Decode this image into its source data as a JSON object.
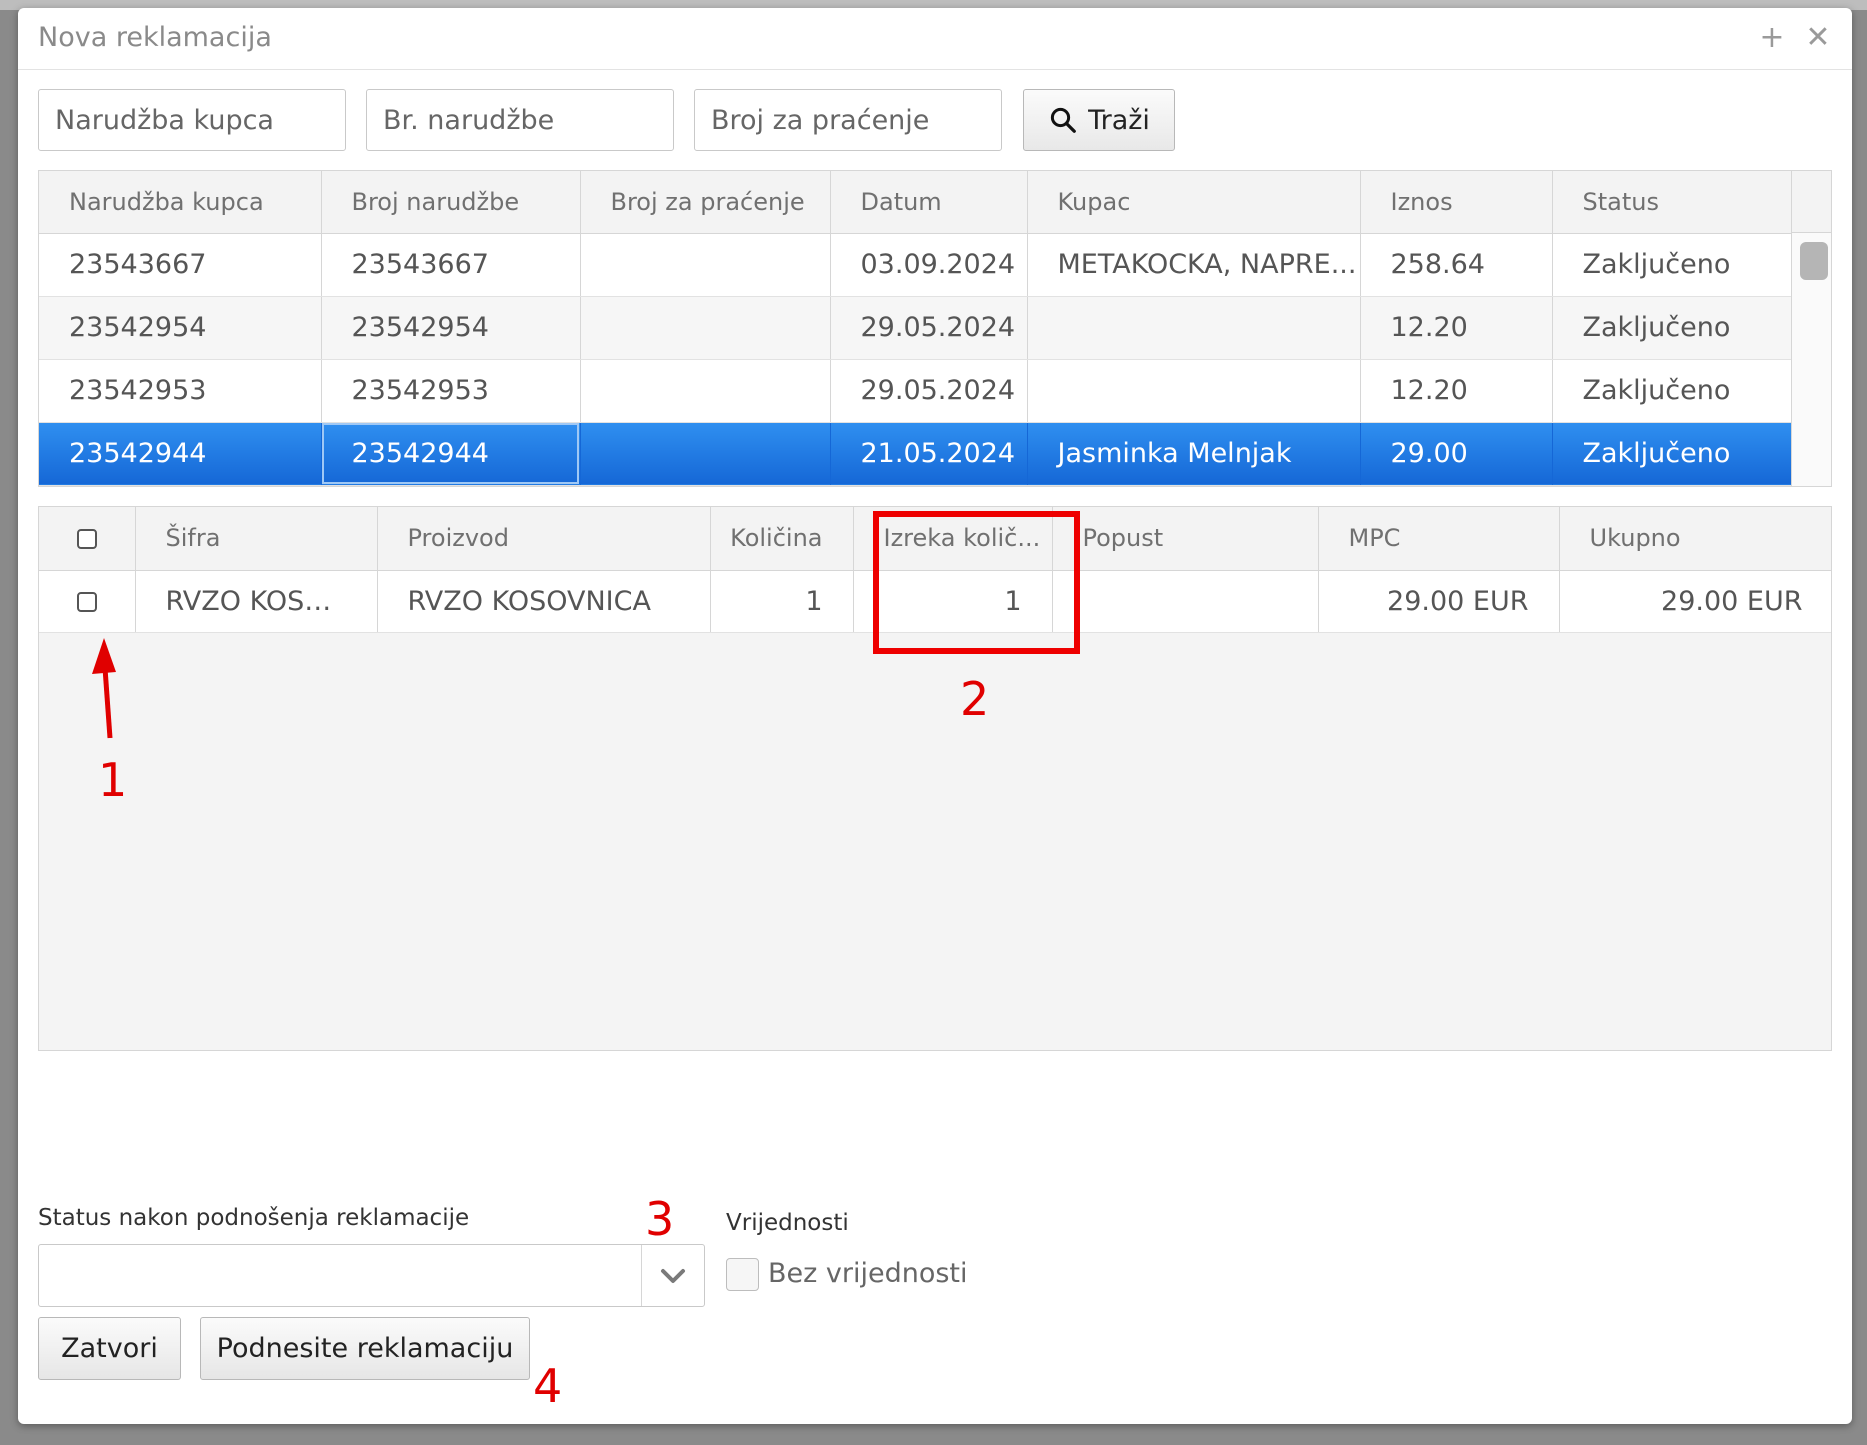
{
  "dialog": {
    "title": "Nova reklamacija",
    "maximize_glyph": "+",
    "close_glyph": "✕"
  },
  "search": {
    "customer_order_placeholder": "Narudžba kupca",
    "order_number_placeholder": "Br. narudžbe",
    "tracking_placeholder": "Broj za praćenje",
    "button_label": "Traži",
    "button_icon": "search-icon"
  },
  "orders": {
    "columns": [
      "Narudžba kupca",
      "Broj narudžbe",
      "Broj za praćenje",
      "Datum",
      "Kupac",
      "Iznos",
      "Status"
    ],
    "rows": [
      {
        "customer_order": "23543667",
        "order_number": "23543667",
        "tracking": "",
        "date": "03.09.2024",
        "customer": "METAKOCKA, NAPRE...",
        "amount": "258.64",
        "status": "Zaključeno"
      },
      {
        "customer_order": "23542954",
        "order_number": "23542954",
        "tracking": "",
        "date": "29.05.2024",
        "customer": "",
        "amount": "12.20",
        "status": "Zaključeno"
      },
      {
        "customer_order": "23542953",
        "order_number": "23542953",
        "tracking": "",
        "date": "29.05.2024",
        "customer": "",
        "amount": "12.20",
        "status": "Zaključeno"
      },
      {
        "customer_order": "23542944",
        "order_number": "23542944",
        "tracking": "",
        "date": "21.05.2024",
        "customer": "Jasminka Melnjak",
        "amount": "29.00",
        "status": "Zaključeno"
      }
    ],
    "selected_row": 3
  },
  "items": {
    "columns": [
      "Šifra",
      "Proizvod",
      "Količina",
      "Izreka količ...",
      "Popust",
      "MPC",
      "Ukupno"
    ],
    "rows": [
      {
        "code": "RVZO KOSOV...",
        "product": "RVZO KOSOVNICA",
        "quantity": "1",
        "claim_quantity": "1",
        "discount": "",
        "price": "29.00 EUR",
        "total": "29.00 EUR"
      }
    ]
  },
  "annotations": {
    "n1": "1",
    "n2": "2",
    "n3": "3",
    "n4": "4",
    "color": "#ee0000"
  },
  "footer": {
    "status_label": "Status nakon podnošenja reklamacije",
    "status_value": "",
    "values_label": "Vrijednosti",
    "no_values_label": "Bez vrijednosti",
    "close_button": "Zatvori",
    "submit_button": "Podnesite reklamaciju"
  },
  "colors": {
    "selection": "#1a73e0",
    "annotation": "#ee0000"
  }
}
